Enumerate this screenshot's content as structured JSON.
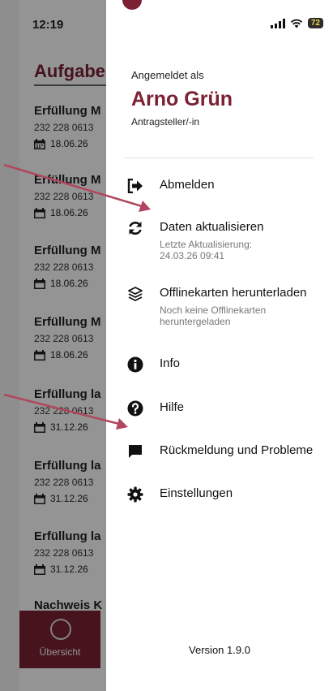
{
  "background": {
    "status_time": "12:19",
    "title": "Aufgabe",
    "tasks": [
      {
        "title": "Erfüllung M",
        "id": "232 228 0613",
        "date": "18.06.26"
      },
      {
        "title": "Erfüllung M",
        "id": "232 228 0613",
        "date": "18.06.26"
      },
      {
        "title": "Erfüllung M",
        "id": "232 228 0613",
        "date": "18.06.26"
      },
      {
        "title": "Erfüllung M",
        "id": "232 228 0613",
        "date": "18.06.26"
      },
      {
        "title": "Erfüllung la",
        "id": "232 228 0613",
        "date": "31.12.26"
      },
      {
        "title": "Erfüllung la",
        "id": "232 228 0613",
        "date": "31.12.26"
      },
      {
        "title": "Erfüllung la",
        "id": "232 228 0613",
        "date": "31.12.26"
      },
      {
        "title": "Nachweis K",
        "id": "",
        "date": ""
      }
    ],
    "nav_label": "Übersicht"
  },
  "status_bar": {
    "battery": "72"
  },
  "account": {
    "label": "Angemeldet als",
    "name": "Arno Grün",
    "role": "Antragsteller/-in"
  },
  "menu": [
    {
      "label": "Abmelden",
      "icon": "sign-out-icon"
    },
    {
      "label": "Daten aktualisieren",
      "sub": "Letzte Aktualisierung:\n24.03.26 09:41",
      "icon": "refresh-icon"
    },
    {
      "label": "Offlinekarten herunterladen",
      "sub": "Noch keine Offlinekarten\nheruntergeladen",
      "icon": "layers-icon"
    },
    {
      "label": "Info",
      "icon": "info-icon"
    },
    {
      "label": "Hilfe",
      "icon": "help-icon"
    },
    {
      "label": "Rückmeldung und Probleme",
      "icon": "feedback-icon"
    },
    {
      "label": "Einstellungen",
      "icon": "gear-icon"
    }
  ],
  "version": "Version 1.9.0",
  "colors": {
    "accent": "#7b2133",
    "arrow": "#b0475e"
  }
}
